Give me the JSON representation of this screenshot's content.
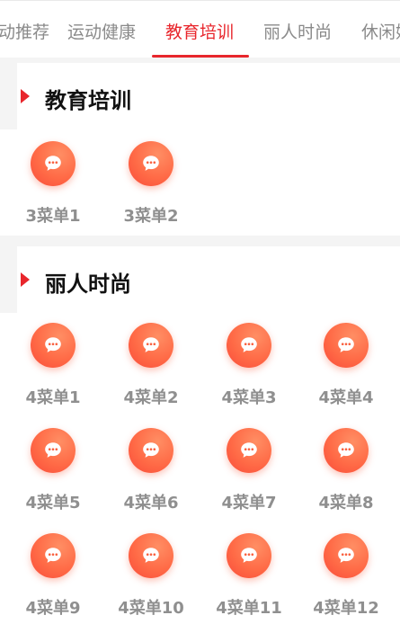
{
  "tabs": [
    {
      "label": "动推荐"
    },
    {
      "label": "运动健康"
    },
    {
      "label": "教育培训"
    },
    {
      "label": "丽人时尚"
    },
    {
      "label": "休闲娱"
    }
  ],
  "sections": [
    {
      "title": "教育培训",
      "items": [
        {
          "label": "3菜单1",
          "icon": "chat-bubble-icon"
        },
        {
          "label": "3菜单2",
          "icon": "chat-bubble-icon"
        }
      ]
    },
    {
      "title": "丽人时尚",
      "items": [
        {
          "label": "4菜单1",
          "icon": "chat-bubble-icon"
        },
        {
          "label": "4菜单2",
          "icon": "chat-bubble-icon"
        },
        {
          "label": "4菜单3",
          "icon": "chat-bubble-icon"
        },
        {
          "label": "4菜单4",
          "icon": "chat-bubble-icon"
        },
        {
          "label": "4菜单5",
          "icon": "chat-bubble-icon"
        },
        {
          "label": "4菜单6",
          "icon": "chat-bubble-icon"
        },
        {
          "label": "4菜单7",
          "icon": "chat-bubble-icon"
        },
        {
          "label": "4菜单8",
          "icon": "chat-bubble-icon"
        },
        {
          "label": "4菜单9",
          "icon": "chat-bubble-icon"
        },
        {
          "label": "4菜单10",
          "icon": "chat-bubble-icon"
        },
        {
          "label": "4菜单11",
          "icon": "chat-bubble-icon"
        },
        {
          "label": "4菜单12",
          "icon": "chat-bubble-icon"
        }
      ]
    }
  ],
  "colors": {
    "accent": "#e8262c",
    "icon_gradient_start": "#ff8e64",
    "icon_gradient_end": "#f94b3a",
    "label_gray": "#8f8f8f"
  }
}
